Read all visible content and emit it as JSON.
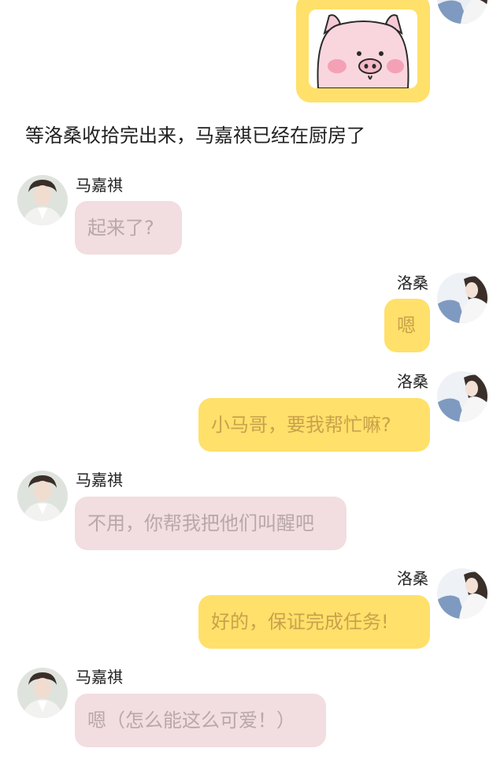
{
  "narration": "等洛桑收拾完出来，马嘉祺已经在厨房了",
  "sticker": {
    "icon": "pig-sticker-icon"
  },
  "messages": [
    {
      "side": "left",
      "sender": "马嘉祺",
      "text": "起来了?"
    },
    {
      "side": "right",
      "sender": "洛桑",
      "text": "嗯"
    },
    {
      "side": "right",
      "sender": "洛桑",
      "text": "小马哥，要我帮忙嘛?"
    },
    {
      "side": "left",
      "sender": "马嘉祺",
      "text": "不用，你帮我把他们叫醒吧"
    },
    {
      "side": "right",
      "sender": "洛桑",
      "text": "好的，保证完成任务!"
    },
    {
      "side": "left",
      "sender": "马嘉祺",
      "text": "嗯（怎么能这么可爱！）"
    }
  ],
  "colors": {
    "left_bubble": "#f2dde0",
    "left_text": "#b8a8aa",
    "right_bubble": "#ffe06a",
    "right_text": "#c9a24c"
  }
}
